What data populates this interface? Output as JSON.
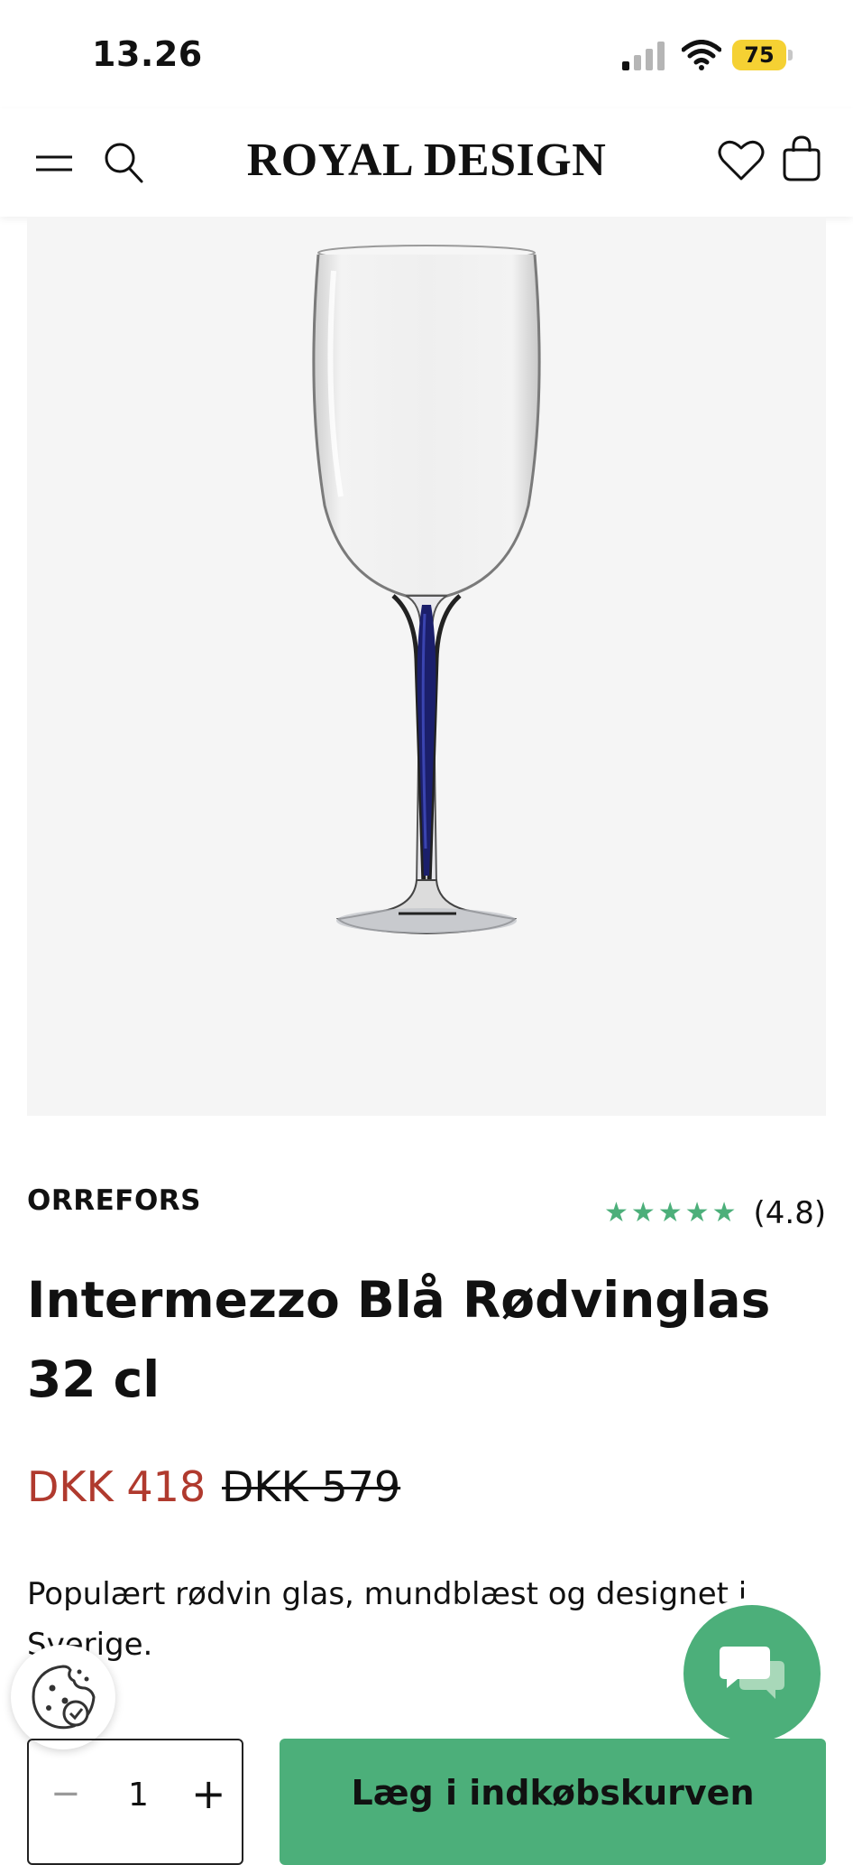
{
  "status_bar": {
    "time": "13.26",
    "battery": "75",
    "signal_icon": "cellular-signal-icon",
    "wifi_icon": "wifi-icon"
  },
  "header": {
    "brand": "ROYAL DESIGN",
    "menu_icon": "hamburger-menu-icon",
    "search_icon": "search-icon",
    "wishlist_icon": "heart-icon",
    "cart_icon": "shopping-bag-icon"
  },
  "product": {
    "image_alt": "wine-glass-with-blue-stem",
    "brand": "ORREFORS",
    "stars": "★★★★★",
    "rating": "(4.8)",
    "rating_fraction": 0.96,
    "title": "Intermezzo Blå Rødvinglas 32 cl",
    "price_now": "DKK 418",
    "price_old": "DKK 579",
    "description": "Populært rødvin glas, mundblæst og designet i Sverige."
  },
  "actions": {
    "quantity": "1",
    "minus": "−",
    "plus": "+",
    "add_to_cart": "Læg i indkøbskurven"
  },
  "floating": {
    "chat_icon": "chat-bubbles-icon",
    "cookie_icon": "cookie-consent-icon"
  },
  "colors": {
    "accent_green": "#4caf7a",
    "sale_red": "#b03a2e",
    "battery_yellow": "#f5d133",
    "image_background": "#f5f5f5"
  }
}
